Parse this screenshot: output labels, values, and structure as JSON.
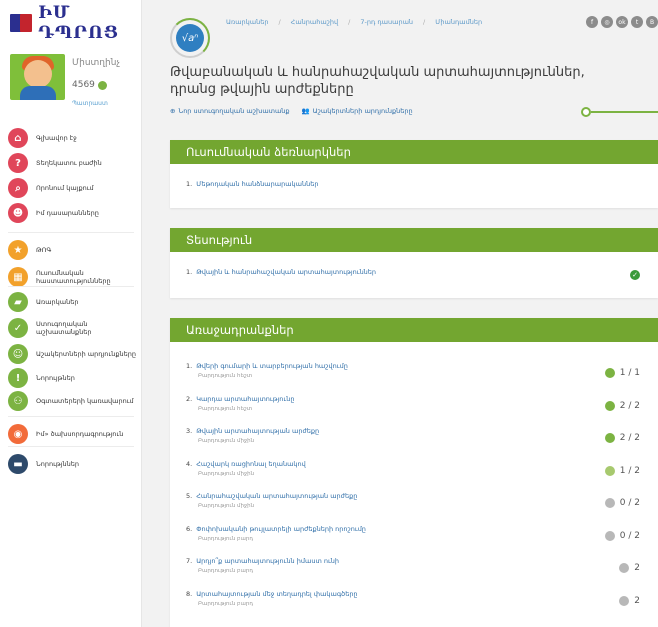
{
  "app": {
    "logo_text": "ԻՄ ԴՊՐՈՑ"
  },
  "profile": {
    "name": "Միստղինչ",
    "points": "4569",
    "link": "Պատրաստ"
  },
  "nav": {
    "group1": [
      {
        "label": "Գլխավոր էջ",
        "icon": "home-icon",
        "color": "#e0465a"
      },
      {
        "label": "Տեղեկատու բաժին",
        "icon": "question-icon",
        "color": "#e0465a"
      },
      {
        "label": "Որոնում կայքում",
        "icon": "search-icon",
        "color": "#e0465a"
      },
      {
        "label": "Իմ դասարանները",
        "icon": "person-icon",
        "color": "#e0465a"
      }
    ],
    "group2": [
      {
        "label": "ԹՈԳ",
        "icon": "star-icon",
        "color": "#f2a12b"
      },
      {
        "label": "Ուսումնական հաստատությունները",
        "icon": "building-icon",
        "color": "#f2a12b"
      }
    ],
    "group3": [
      {
        "label": "Առարկաներ",
        "icon": "book-icon",
        "color": "#7cb342"
      },
      {
        "label": "Ստուգողական աշխատանքներ",
        "icon": "check-icon",
        "color": "#7cb342"
      },
      {
        "label": "Աշակերտների արդյունքները",
        "icon": "group-icon",
        "color": "#7cb342"
      },
      {
        "label": "Նորույթներ",
        "icon": "exclamation-icon",
        "color": "#7cb342"
      },
      {
        "label": "Օգտատերերի կառավարում",
        "icon": "users-icon",
        "color": "#7cb342"
      }
    ],
    "group4": [
      {
        "label": "Իմ» ծախսորդագրություն",
        "icon": "wallet-icon",
        "color": "#f26b3a"
      }
    ],
    "group5": [
      {
        "label": "Նորությններ",
        "icon": "chat-icon",
        "color": "#2e4a6b"
      }
    ]
  },
  "topic_logo": {
    "text": "√aⁿ"
  },
  "breadcrumb": [
    "Առարկաներ",
    "Հանրահաշիվ",
    "7-րդ դասարան",
    "Միանդամներ"
  ],
  "socials": [
    "f",
    "◎",
    "ok",
    "t",
    "В"
  ],
  "page_title": "Թվաբանական և հանրահաշվական արտահայտություններ, դրանց թվային արժեքները",
  "actions": {
    "new_test": "Նոր ստուգողական աշխատանք",
    "student_results": "Աշակերտների արդյունքները"
  },
  "sections": {
    "study": {
      "title": "Ուսումնական ձեռնարկներ",
      "items": [
        {
          "num": "1.",
          "label": "Մեթոդական հանձնարարականներ"
        }
      ]
    },
    "theory": {
      "title": "Տեսություն",
      "items": [
        {
          "num": "1.",
          "label": "Թվային և հանրահաշվական արտահայտություններ"
        }
      ]
    },
    "exercises": {
      "title": "Առաջադրանքներ",
      "items": [
        {
          "num": "1.",
          "label": "Թվերի գումարի և տարբերության հաշվումը",
          "level": "Բարդություն հեշտ",
          "score": "1 / 1",
          "color": "#7cb342"
        },
        {
          "num": "2.",
          "label": "Կարդա արտահայտությունը",
          "level": "Բարդություն հեշտ",
          "score": "2 / 2",
          "color": "#7cb342"
        },
        {
          "num": "3.",
          "label": "Թվային արտահայտության արժեքը",
          "level": "Բարդություն միջին",
          "score": "2 / 2",
          "color": "#7cb342"
        },
        {
          "num": "4.",
          "label": "Հաշվարկ ռացիոնալ եղանակով",
          "level": "Բարդություն միջին",
          "score": "1 / 2",
          "color": "#a7c96e"
        },
        {
          "num": "5.",
          "label": "Հանրահաշվական արտահայտության արժեքը",
          "level": "Բարդություն միջին",
          "score": "0 / 2",
          "color": "#b8b8b8"
        },
        {
          "num": "6.",
          "label": "Փոփոխականի թույլատրելի արժեքների որոշումը",
          "level": "Բարդություն բարդ",
          "score": "0 / 2",
          "color": "#b8b8b8"
        },
        {
          "num": "7.",
          "label": "Արդյո՞ք արտահայտությունն իմաստ ունի",
          "level": "Բարդություն բարդ",
          "score": "2",
          "color": "#b8b8b8"
        },
        {
          "num": "8.",
          "label": "Արտահայտության մեջ տեղադրել փակագծերը",
          "level": "Բարդություն բարդ",
          "score": "2",
          "color": "#b8b8b8"
        }
      ]
    }
  }
}
